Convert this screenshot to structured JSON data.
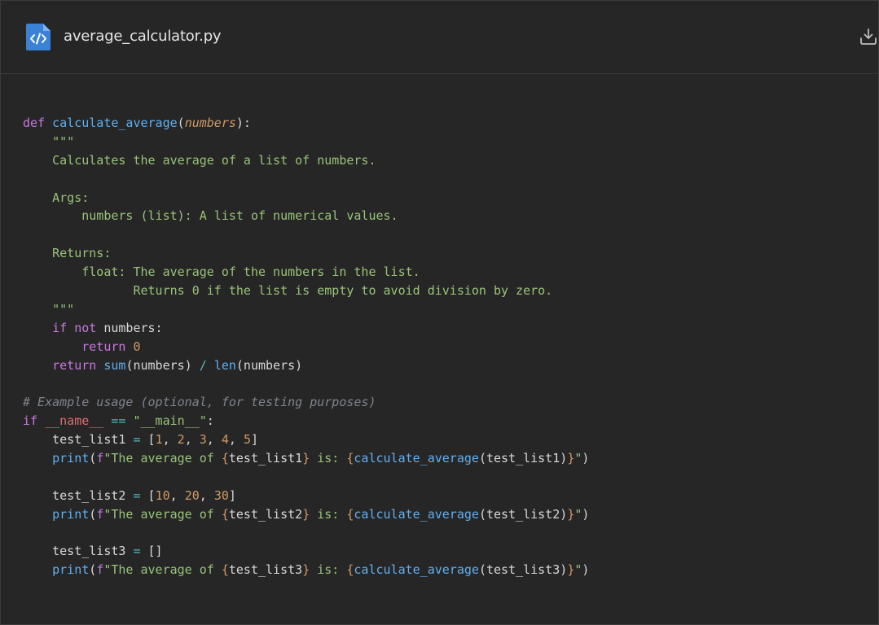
{
  "header": {
    "file_name": "average_calculator.py",
    "file_icon": "code-file-icon",
    "download_icon": "download-icon",
    "accent_color": "#3b82d6"
  },
  "code": {
    "language": "python",
    "lines": [
      [
        [
          "kw",
          "def"
        ],
        [
          "plain",
          " "
        ],
        [
          "fn",
          "calculate_average"
        ],
        [
          "plain",
          "("
        ],
        [
          "param",
          "numbers"
        ],
        [
          "plain",
          "):"
        ]
      ],
      [
        [
          "str",
          "    \"\"\""
        ]
      ],
      [
        [
          "str",
          "    Calculates the average of a list of numbers."
        ]
      ],
      [
        [
          "plain",
          ""
        ]
      ],
      [
        [
          "str",
          "    Args:"
        ]
      ],
      [
        [
          "str",
          "        numbers (list): A list of numerical values."
        ]
      ],
      [
        [
          "plain",
          ""
        ]
      ],
      [
        [
          "str",
          "    Returns:"
        ]
      ],
      [
        [
          "str",
          "        float: The average of the numbers in the list."
        ]
      ],
      [
        [
          "str",
          "               Returns 0 if the list is empty to avoid division by zero."
        ]
      ],
      [
        [
          "str",
          "    \"\"\""
        ]
      ],
      [
        [
          "plain",
          "    "
        ],
        [
          "kw",
          "if"
        ],
        [
          "plain",
          " "
        ],
        [
          "kw",
          "not"
        ],
        [
          "plain",
          " numbers:"
        ]
      ],
      [
        [
          "plain",
          "        "
        ],
        [
          "kw",
          "return"
        ],
        [
          "plain",
          " "
        ],
        [
          "num",
          "0"
        ]
      ],
      [
        [
          "plain",
          "    "
        ],
        [
          "kw",
          "return"
        ],
        [
          "plain",
          " "
        ],
        [
          "fn",
          "sum"
        ],
        [
          "plain",
          "(numbers) "
        ],
        [
          "op",
          "/"
        ],
        [
          "plain",
          " "
        ],
        [
          "fn",
          "len"
        ],
        [
          "plain",
          "(numbers)"
        ]
      ],
      [
        [
          "plain",
          ""
        ]
      ],
      [
        [
          "cmt",
          "# Example usage (optional, for testing purposes)"
        ]
      ],
      [
        [
          "kw",
          "if"
        ],
        [
          "plain",
          " "
        ],
        [
          "dunder",
          "__name__"
        ],
        [
          "plain",
          " "
        ],
        [
          "op",
          "=="
        ],
        [
          "plain",
          " "
        ],
        [
          "str",
          "\"__main__\""
        ],
        [
          "plain",
          ":"
        ]
      ],
      [
        [
          "plain",
          "    test_list1 "
        ],
        [
          "op",
          "="
        ],
        [
          "plain",
          " ["
        ],
        [
          "num",
          "1"
        ],
        [
          "plain",
          ", "
        ],
        [
          "num",
          "2"
        ],
        [
          "plain",
          ", "
        ],
        [
          "num",
          "3"
        ],
        [
          "plain",
          ", "
        ],
        [
          "num",
          "4"
        ],
        [
          "plain",
          ", "
        ],
        [
          "num",
          "5"
        ],
        [
          "plain",
          "]"
        ]
      ],
      [
        [
          "plain",
          "    "
        ],
        [
          "fn",
          "print"
        ],
        [
          "plain",
          "("
        ],
        [
          "kw",
          "f"
        ],
        [
          "str",
          "\"The average of "
        ],
        [
          "brace",
          "{"
        ],
        [
          "plain",
          "test_list1"
        ],
        [
          "brace",
          "}"
        ],
        [
          "str",
          " is: "
        ],
        [
          "brace",
          "{"
        ],
        [
          "fn",
          "calculate_average"
        ],
        [
          "plain",
          "(test_list1)"
        ],
        [
          "brace",
          "}"
        ],
        [
          "str",
          "\""
        ],
        [
          "plain",
          ")"
        ]
      ],
      [
        [
          "plain",
          ""
        ]
      ],
      [
        [
          "plain",
          "    test_list2 "
        ],
        [
          "op",
          "="
        ],
        [
          "plain",
          " ["
        ],
        [
          "num",
          "10"
        ],
        [
          "plain",
          ", "
        ],
        [
          "num",
          "20"
        ],
        [
          "plain",
          ", "
        ],
        [
          "num",
          "30"
        ],
        [
          "plain",
          "]"
        ]
      ],
      [
        [
          "plain",
          "    "
        ],
        [
          "fn",
          "print"
        ],
        [
          "plain",
          "("
        ],
        [
          "kw",
          "f"
        ],
        [
          "str",
          "\"The average of "
        ],
        [
          "brace",
          "{"
        ],
        [
          "plain",
          "test_list2"
        ],
        [
          "brace",
          "}"
        ],
        [
          "str",
          " is: "
        ],
        [
          "brace",
          "{"
        ],
        [
          "fn",
          "calculate_average"
        ],
        [
          "plain",
          "(test_list2)"
        ],
        [
          "brace",
          "}"
        ],
        [
          "str",
          "\""
        ],
        [
          "plain",
          ")"
        ]
      ],
      [
        [
          "plain",
          ""
        ]
      ],
      [
        [
          "plain",
          "    test_list3 "
        ],
        [
          "op",
          "="
        ],
        [
          "plain",
          " []"
        ]
      ],
      [
        [
          "plain",
          "    "
        ],
        [
          "fn",
          "print"
        ],
        [
          "plain",
          "("
        ],
        [
          "kw",
          "f"
        ],
        [
          "str",
          "\"The average of "
        ],
        [
          "brace",
          "{"
        ],
        [
          "plain",
          "test_list3"
        ],
        [
          "brace",
          "}"
        ],
        [
          "str",
          " is: "
        ],
        [
          "brace",
          "{"
        ],
        [
          "fn",
          "calculate_average"
        ],
        [
          "plain",
          "(test_list3)"
        ],
        [
          "brace",
          "}"
        ],
        [
          "str",
          "\""
        ],
        [
          "plain",
          ")"
        ]
      ]
    ]
  }
}
